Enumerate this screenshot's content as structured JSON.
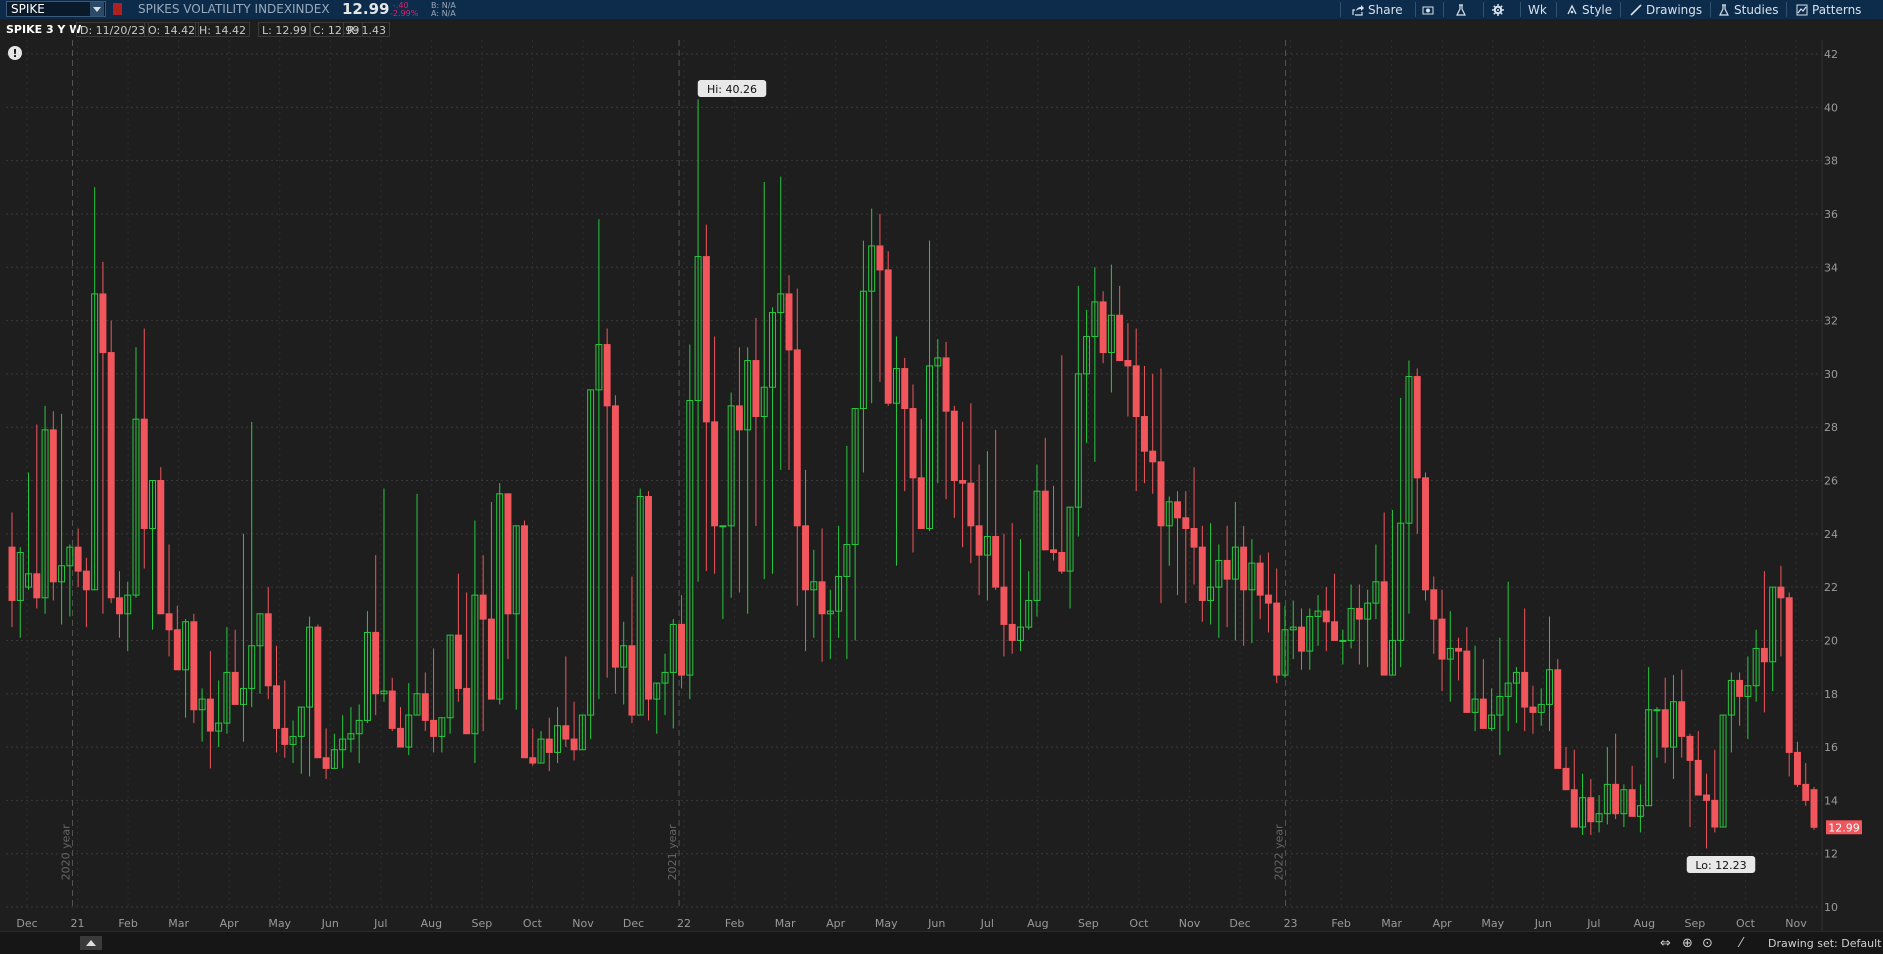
{
  "toolbar": {
    "symbol": "SPIKE",
    "description": "SPIKES VOLATILITY INDEX",
    "type": "INDEX",
    "price": "12.99",
    "change_abs": "-.40",
    "change_pct": "-2.99%",
    "bid": "B: N/A",
    "ask": "A: N/A",
    "share_label": "Share",
    "timeframe_label": "Wk",
    "style_label": "Style",
    "drawings_label": "Drawings",
    "studies_label": "Studies",
    "patterns_label": "Patterns"
  },
  "info": {
    "title": "SPIKE 3 Y W",
    "date": "D: 11/20/23",
    "open": "O: 14.42",
    "high": "H: 14.42",
    "low": "L: 12.99",
    "close": "C: 12.99",
    "range": "R: 1.43"
  },
  "bottom": {
    "drawing_set": "Drawing set: Default"
  },
  "colors": {
    "up": "#27c93f",
    "down": "#f0565c",
    "background": "#1e1e1e",
    "grid": "#3a3a3a",
    "topbar": "#0d2b4a"
  },
  "chart_data": {
    "type": "candlestick",
    "ylim": [
      10,
      43
    ],
    "y_ticks": [
      10,
      12,
      14,
      16,
      18,
      20,
      22,
      24,
      26,
      28,
      30,
      32,
      34,
      36,
      38,
      40,
      42
    ],
    "x_ticks": [
      "Dec",
      "21",
      "Feb",
      "Mar",
      "Apr",
      "May",
      "Jun",
      "Jul",
      "Aug",
      "Sep",
      "Oct",
      "Nov",
      "Dec",
      "22",
      "Feb",
      "Mar",
      "Apr",
      "May",
      "Jun",
      "Jul",
      "Aug",
      "Sep",
      "Oct",
      "Nov",
      "Dec",
      "23",
      "Feb",
      "Mar",
      "Apr",
      "May",
      "Jun",
      "Jul",
      "Aug",
      "Sep",
      "Oct",
      "Nov"
    ],
    "year_labels": [
      "2020 year",
      "2021 year",
      "2022 year"
    ],
    "annotations": {
      "high": "Hi: 40.26",
      "low": "Lo: 12.23",
      "last": "12.99"
    },
    "high_value": 40.26,
    "low_value": 12.23,
    "last_value": 12.99,
    "candles": [
      [
        23.5,
        24.8,
        20.5,
        21.5
      ],
      [
        21.5,
        23.5,
        20.1,
        23.3
      ],
      [
        22.0,
        26.3,
        21.9,
        22.5
      ],
      [
        22.5,
        28.1,
        21.2,
        21.6
      ],
      [
        21.6,
        28.8,
        21.0,
        27.9
      ],
      [
        27.9,
        28.6,
        21.5,
        22.2
      ],
      [
        22.2,
        28.5,
        20.6,
        22.8
      ],
      [
        22.8,
        23.6,
        20.9,
        23.5
      ],
      [
        23.5,
        24.2,
        22.0,
        22.6
      ],
      [
        22.6,
        23.1,
        20.5,
        21.9
      ],
      [
        21.9,
        37.0,
        21.9,
        33.0
      ],
      [
        33.0,
        34.2,
        21.0,
        30.8
      ],
      [
        30.8,
        32.0,
        21.4,
        21.6
      ],
      [
        21.6,
        22.6,
        20.1,
        21.0
      ],
      [
        21.0,
        22.2,
        19.6,
        21.7
      ],
      [
        21.7,
        31.0,
        21.6,
        28.3
      ],
      [
        28.3,
        31.7,
        22.7,
        24.2
      ],
      [
        24.2,
        25.8,
        20.4,
        26.0
      ],
      [
        26.0,
        26.5,
        21.1,
        21.0
      ],
      [
        21.0,
        23.6,
        19.4,
        20.4
      ],
      [
        20.4,
        21.3,
        18.9,
        18.9
      ],
      [
        18.9,
        20.8,
        17.1,
        20.7
      ],
      [
        20.7,
        21.0,
        16.9,
        17.4
      ],
      [
        17.4,
        18.2,
        16.2,
        17.8
      ],
      [
        17.8,
        19.6,
        15.2,
        16.6
      ],
      [
        16.6,
        18.5,
        16.0,
        16.9
      ],
      [
        16.9,
        20.5,
        16.5,
        18.8
      ],
      [
        18.8,
        20.4,
        17.6,
        17.6
      ],
      [
        17.6,
        24.0,
        16.2,
        18.2
      ],
      [
        18.2,
        28.2,
        17.5,
        19.8
      ],
      [
        19.8,
        21.0,
        18.0,
        21.0
      ],
      [
        21.0,
        22.0,
        17.8,
        18.3
      ],
      [
        18.3,
        19.8,
        15.8,
        16.7
      ],
      [
        16.7,
        18.5,
        15.6,
        16.1
      ],
      [
        16.1,
        17.0,
        15.4,
        16.4
      ],
      [
        16.4,
        16.8,
        15.0,
        17.5
      ],
      [
        17.5,
        20.9,
        14.9,
        20.5
      ],
      [
        20.5,
        20.6,
        16.1,
        15.6
      ],
      [
        15.6,
        16.7,
        14.8,
        15.2
      ],
      [
        15.2,
        16.5,
        15.4,
        15.9
      ],
      [
        15.9,
        17.2,
        15.2,
        16.3
      ],
      [
        16.3,
        17.5,
        15.8,
        16.5
      ],
      [
        16.5,
        17.6,
        15.4,
        17.0
      ],
      [
        17.0,
        21.1,
        16.9,
        20.3
      ],
      [
        20.3,
        23.2,
        17.2,
        18.0
      ],
      [
        18.0,
        25.7,
        17.7,
        18.1
      ],
      [
        18.1,
        18.6,
        16.6,
        16.7
      ],
      [
        16.7,
        17.5,
        16.2,
        16.0
      ],
      [
        16.0,
        18.4,
        15.7,
        17.2
      ],
      [
        17.2,
        25.5,
        17.2,
        18.0
      ],
      [
        18.0,
        18.8,
        16.6,
        17.0
      ],
      [
        17.0,
        19.7,
        15.8,
        16.4
      ],
      [
        16.4,
        16.8,
        15.8,
        17.1
      ],
      [
        17.1,
        20.1,
        16.5,
        20.2
      ],
      [
        20.2,
        22.5,
        17.7,
        18.2
      ],
      [
        18.2,
        21.8,
        16.8,
        16.5
      ],
      [
        16.5,
        24.5,
        15.4,
        21.7
      ],
      [
        21.7,
        23.2,
        16.6,
        20.8
      ],
      [
        20.8,
        25.2,
        17.8,
        17.8
      ],
      [
        17.8,
        25.9,
        17.6,
        25.5
      ],
      [
        25.5,
        24.0,
        19.3,
        21.0
      ],
      [
        21.0,
        22.0,
        17.4,
        24.3
      ],
      [
        24.3,
        24.5,
        17.0,
        15.6
      ],
      [
        15.6,
        16.7,
        15.3,
        15.4
      ],
      [
        15.4,
        16.6,
        15.7,
        16.3
      ],
      [
        16.3,
        17.1,
        15.1,
        15.8
      ],
      [
        15.8,
        17.5,
        15.4,
        16.8
      ],
      [
        16.8,
        19.4,
        16.0,
        16.3
      ],
      [
        16.3,
        17.7,
        15.5,
        15.9
      ],
      [
        15.9,
        16.3,
        16.1,
        17.2
      ],
      [
        17.2,
        25.8,
        16.3,
        29.4
      ],
      [
        29.4,
        35.8,
        17.8,
        31.1
      ],
      [
        31.1,
        31.7,
        18.6,
        28.8
      ],
      [
        28.8,
        29.2,
        18.0,
        19.0
      ],
      [
        19.0,
        20.7,
        17.6,
        19.8
      ],
      [
        19.8,
        22.4,
        16.9,
        17.2
      ],
      [
        17.2,
        25.7,
        17.5,
        25.4
      ],
      [
        25.4,
        25.6,
        17.0,
        17.8
      ],
      [
        17.8,
        17.8,
        16.5,
        18.4
      ],
      [
        18.4,
        19.5,
        17.2,
        18.8
      ],
      [
        18.8,
        20.8,
        16.7,
        20.6
      ],
      [
        20.6,
        21.7,
        18.2,
        18.7
      ],
      [
        18.7,
        31.1,
        17.8,
        29.0
      ],
      [
        29.0,
        40.3,
        22.2,
        34.4
      ],
      [
        34.4,
        35.6,
        22.6,
        28.2
      ],
      [
        28.2,
        31.4,
        22.5,
        24.3
      ],
      [
        24.3,
        24.2,
        20.8,
        24.3
      ],
      [
        24.3,
        29.3,
        21.6,
        28.8
      ],
      [
        28.8,
        31.0,
        21.8,
        27.9
      ],
      [
        27.9,
        31.0,
        21.0,
        30.5
      ],
      [
        30.5,
        32.1,
        24.3,
        28.4
      ],
      [
        28.4,
        37.2,
        22.3,
        29.5
      ],
      [
        29.5,
        32.5,
        22.5,
        32.3
      ],
      [
        32.3,
        37.4,
        26.4,
        33.0
      ],
      [
        33.0,
        33.7,
        26.4,
        30.9
      ],
      [
        30.9,
        33.2,
        21.3,
        24.3
      ],
      [
        24.3,
        26.4,
        19.6,
        21.9
      ],
      [
        21.9,
        23.4,
        20.1,
        22.2
      ],
      [
        22.2,
        24.2,
        19.2,
        21.0
      ],
      [
        21.0,
        21.9,
        19.3,
        21.1
      ],
      [
        21.1,
        24.3,
        20.1,
        22.4
      ],
      [
        22.4,
        27.3,
        19.3,
        23.6
      ],
      [
        23.6,
        28.5,
        20.0,
        28.7
      ],
      [
        28.7,
        35.0,
        26.3,
        33.1
      ],
      [
        33.1,
        36.2,
        28.9,
        34.8
      ],
      [
        34.8,
        36.0,
        29.7,
        33.9
      ],
      [
        33.9,
        34.6,
        28.8,
        28.9
      ],
      [
        28.9,
        31.4,
        22.8,
        30.2
      ],
      [
        30.2,
        30.6,
        25.6,
        28.7
      ],
      [
        28.7,
        29.6,
        23.3,
        26.1
      ],
      [
        26.1,
        28.3,
        24.4,
        24.2
      ],
      [
        24.2,
        35.0,
        24.1,
        30.3
      ],
      [
        30.3,
        31.3,
        25.9,
        30.6
      ],
      [
        30.6,
        31.2,
        25.3,
        28.6
      ],
      [
        28.6,
        28.8,
        24.6,
        26.0
      ],
      [
        26.0,
        28.2,
        23.5,
        25.9
      ],
      [
        25.9,
        28.9,
        22.9,
        24.3
      ],
      [
        24.3,
        26.6,
        21.7,
        23.2
      ],
      [
        23.2,
        27.1,
        21.5,
        23.9
      ],
      [
        23.9,
        27.9,
        21.9,
        22.0
      ],
      [
        22.0,
        24.0,
        19.4,
        20.6
      ],
      [
        20.6,
        24.4,
        19.5,
        20.0
      ],
      [
        20.0,
        23.8,
        19.6,
        20.5
      ],
      [
        20.5,
        22.6,
        20.4,
        21.5
      ],
      [
        21.5,
        26.6,
        20.9,
        25.6
      ],
      [
        25.6,
        27.6,
        23.9,
        23.4
      ],
      [
        23.4,
        25.8,
        23.0,
        23.3
      ],
      [
        23.3,
        30.7,
        22.5,
        22.6
      ],
      [
        22.6,
        24.8,
        21.2,
        25.0
      ],
      [
        25.0,
        33.3,
        23.9,
        30.0
      ],
      [
        30.0,
        32.4,
        27.4,
        31.4
      ],
      [
        31.4,
        34.0,
        26.7,
        32.7
      ],
      [
        32.7,
        33.1,
        30.4,
        30.8
      ],
      [
        30.8,
        34.1,
        29.3,
        32.2
      ],
      [
        32.2,
        33.3,
        30.7,
        30.5
      ],
      [
        30.5,
        31.9,
        28.4,
        30.3
      ],
      [
        30.3,
        31.7,
        25.6,
        28.4
      ],
      [
        28.4,
        30.3,
        25.9,
        27.1
      ],
      [
        27.1,
        30.0,
        25.5,
        26.7
      ],
      [
        26.7,
        30.2,
        21.4,
        24.3
      ],
      [
        24.3,
        25.4,
        22.8,
        25.2
      ],
      [
        25.2,
        25.6,
        21.7,
        24.6
      ],
      [
        24.6,
        25.6,
        21.4,
        24.2
      ],
      [
        24.2,
        26.5,
        22.1,
        23.5
      ],
      [
        23.5,
        24.3,
        20.7,
        21.5
      ],
      [
        21.5,
        24.4,
        20.6,
        22.0
      ],
      [
        22.0,
        23.6,
        20.1,
        23.0
      ],
      [
        23.0,
        24.3,
        20.5,
        22.3
      ],
      [
        22.3,
        25.2,
        20.0,
        23.5
      ],
      [
        23.5,
        24.3,
        19.8,
        21.9
      ],
      [
        21.9,
        23.8,
        19.9,
        22.9
      ],
      [
        22.9,
        23.2,
        20.8,
        21.7
      ],
      [
        21.7,
        23.3,
        20.3,
        21.4
      ],
      [
        21.4,
        22.7,
        18.4,
        18.7
      ],
      [
        18.7,
        21.3,
        18.6,
        20.4
      ],
      [
        20.4,
        21.5,
        19.3,
        20.5
      ],
      [
        20.5,
        21.2,
        18.9,
        19.6
      ],
      [
        19.6,
        21.2,
        18.9,
        20.9
      ],
      [
        20.9,
        21.7,
        19.8,
        21.1
      ],
      [
        21.1,
        22.0,
        19.6,
        20.7
      ],
      [
        20.7,
        22.5,
        20.4,
        20.0
      ],
      [
        20.0,
        20.4,
        19.1,
        20.0
      ],
      [
        20.0,
        22.1,
        19.7,
        21.2
      ],
      [
        21.2,
        22.1,
        19.1,
        20.8
      ],
      [
        20.8,
        21.9,
        19.0,
        21.4
      ],
      [
        21.4,
        23.6,
        20.8,
        22.2
      ],
      [
        22.2,
        24.8,
        19.8,
        18.7
      ],
      [
        18.7,
        24.9,
        19.3,
        20.0
      ],
      [
        20.0,
        29.1,
        19.0,
        24.4
      ],
      [
        24.4,
        30.5,
        21.0,
        29.9
      ],
      [
        29.9,
        30.2,
        24.0,
        26.1
      ],
      [
        26.1,
        26.3,
        21.5,
        21.9
      ],
      [
        21.9,
        22.4,
        19.5,
        20.8
      ],
      [
        20.8,
        21.9,
        18.1,
        19.3
      ],
      [
        19.3,
        21.1,
        17.7,
        19.7
      ],
      [
        19.7,
        20.1,
        18.5,
        19.6
      ],
      [
        19.6,
        20.5,
        17.5,
        17.3
      ],
      [
        17.3,
        19.8,
        16.6,
        17.8
      ],
      [
        17.8,
        19.3,
        16.9,
        16.7
      ],
      [
        16.7,
        18.2,
        16.6,
        17.2
      ],
      [
        17.2,
        20.1,
        15.7,
        17.9
      ],
      [
        17.9,
        22.2,
        16.6,
        18.4
      ],
      [
        18.4,
        19.0,
        16.9,
        18.8
      ],
      [
        18.8,
        21.2,
        16.6,
        17.5
      ],
      [
        17.5,
        18.3,
        16.5,
        17.3
      ],
      [
        17.3,
        18.2,
        16.8,
        17.6
      ],
      [
        17.6,
        20.9,
        16.6,
        18.9
      ],
      [
        18.9,
        19.3,
        15.5,
        15.2
      ],
      [
        15.2,
        16.0,
        14.6,
        14.4
      ],
      [
        14.4,
        15.9,
        13.5,
        13.0
      ],
      [
        13.0,
        15.0,
        12.7,
        14.1
      ],
      [
        14.1,
        14.8,
        12.7,
        13.2
      ],
      [
        13.2,
        14.2,
        12.8,
        13.5
      ],
      [
        13.5,
        16.0,
        13.1,
        14.6
      ],
      [
        14.6,
        16.5,
        13.3,
        13.5
      ],
      [
        13.5,
        14.6,
        13.0,
        14.4
      ],
      [
        14.4,
        15.3,
        13.4,
        13.4
      ],
      [
        13.4,
        14.6,
        12.8,
        13.8
      ],
      [
        13.8,
        19.0,
        13.8,
        17.4
      ],
      [
        17.4,
        17.5,
        15.6,
        17.4
      ],
      [
        17.4,
        18.6,
        15.4,
        16.0
      ],
      [
        16.0,
        18.7,
        14.8,
        17.7
      ],
      [
        17.7,
        18.9,
        15.6,
        16.4
      ],
      [
        16.4,
        16.5,
        13.0,
        15.5
      ],
      [
        15.5,
        16.6,
        14.3,
        14.2
      ],
      [
        14.2,
        15.0,
        12.2,
        14.0
      ],
      [
        14.0,
        15.9,
        12.8,
        13.0
      ],
      [
        13.0,
        15.3,
        13.4,
        17.2
      ],
      [
        17.2,
        18.8,
        15.8,
        18.5
      ],
      [
        18.5,
        18.8,
        16.8,
        17.9
      ],
      [
        17.9,
        19.4,
        16.3,
        18.3
      ],
      [
        18.3,
        20.4,
        17.7,
        19.7
      ],
      [
        19.7,
        22.6,
        17.3,
        19.2
      ],
      [
        19.2,
        22.0,
        18.1,
        22.0
      ],
      [
        22.0,
        22.8,
        19.4,
        21.6
      ],
      [
        21.6,
        21.8,
        14.9,
        15.8
      ],
      [
        15.8,
        16.2,
        14.5,
        14.6
      ],
      [
        14.6,
        15.4,
        13.8,
        14.0
      ],
      [
        14.4,
        14.5,
        12.9,
        12.99
      ]
    ]
  }
}
